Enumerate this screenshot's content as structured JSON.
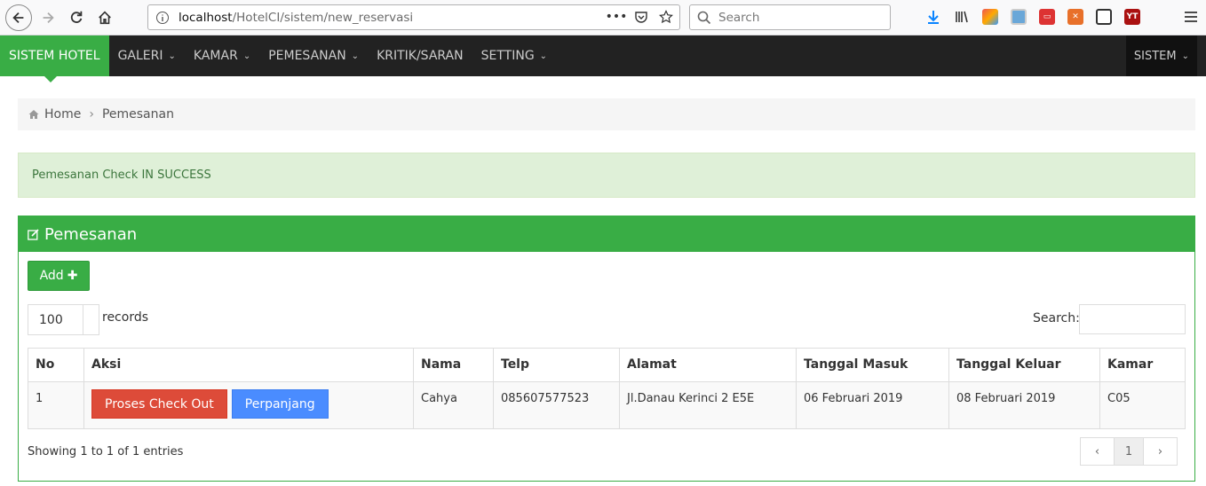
{
  "browser": {
    "url_host": "localhost",
    "url_path": "/HotelCI/sistem/new_reservasi",
    "search_placeholder": "Search",
    "icons": [
      "download-icon",
      "library-icon",
      "extension-1-icon",
      "extension-2-icon",
      "extension-3-icon",
      "extension-4-icon",
      "sidebar-icon",
      "extension-yt-icon"
    ]
  },
  "navbar": {
    "brand": "SISTEM HOTEL",
    "items": [
      {
        "label": "GALERI",
        "dropdown": true
      },
      {
        "label": "KAMAR",
        "dropdown": true
      },
      {
        "label": "PEMESANAN",
        "dropdown": true
      },
      {
        "label": "KRITIK/SARAN",
        "dropdown": false
      },
      {
        "label": "SETTING",
        "dropdown": true
      }
    ],
    "user_menu": "SISTEM"
  },
  "breadcrumb": {
    "home": "Home",
    "current": "Pemesanan"
  },
  "alert": {
    "text": "Pemesanan Check IN SUCCESS"
  },
  "panel": {
    "title": "Pemesanan",
    "add_label": "Add",
    "length_value": "100",
    "records_label": "records",
    "search_label": "Search:",
    "columns": [
      "No",
      "Aksi",
      "Nama",
      "Telp",
      "Alamat",
      "Tanggal Masuk",
      "Tanggal Keluar",
      "Kamar"
    ],
    "rows": [
      {
        "no": "1",
        "checkout_label": "Proses Check Out",
        "extend_label": "Perpanjang",
        "nama": "Cahya",
        "telp": "085607577523",
        "alamat": "Jl.Danau Kerinci 2 E5E",
        "masuk": "06 Februari 2019",
        "keluar": "08 Februari 2019",
        "kamar": "C05"
      }
    ],
    "showing": "Showing 1 to 1 of 1 entries",
    "pagination": {
      "prev": "‹",
      "page": "1",
      "next": "›"
    }
  },
  "colors": {
    "accent": "#39ad45",
    "danger": "#dd4b39",
    "primary": "#4a8cff",
    "navbar": "#222222"
  }
}
